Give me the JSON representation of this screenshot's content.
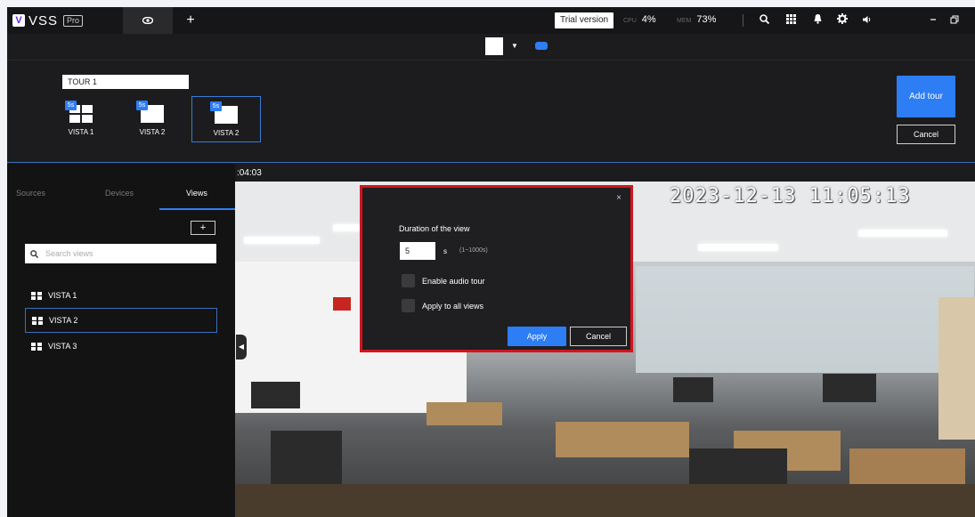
{
  "app": {
    "logo_letter": "V",
    "name": "VSS",
    "edition": "Pro",
    "live_icon": "eye-icon",
    "add_tab_icon": "+"
  },
  "topbar": {
    "trial_label": "Trial version",
    "cpu_label": "CPU",
    "cpu_value": "4%",
    "mem_label": "MEM",
    "mem_value": "73%",
    "icons": [
      "search-icon",
      "apps-grid-icon",
      "bell-icon",
      "gear-icon",
      "volume-icon",
      "minimize-icon",
      "restore-icon"
    ]
  },
  "tour": {
    "name": "TOUR 1",
    "views": [
      {
        "label": "VISTA 1",
        "badge": "5s"
      },
      {
        "label": "VISTA 2",
        "badge": "5s"
      },
      {
        "label": "VISTA 2",
        "badge": "5s"
      }
    ],
    "add_label": "Add tour",
    "cancel_label": "Cancel"
  },
  "sidebar": {
    "tabs": [
      "Sources",
      "Devices",
      "Views"
    ],
    "active_tab": "Views",
    "add_label": "+",
    "search_placeholder": "Search views",
    "views": [
      "VISTA 1",
      "VISTA 2",
      "VISTA 3"
    ],
    "selected_view": "VISTA 2"
  },
  "video": {
    "strip_time": ":04:03",
    "timestamp": "2023-12-13 11:05:13"
  },
  "modal": {
    "close": "×",
    "title": "Duration of the view",
    "duration_value": "5",
    "unit": "s",
    "range": "(1~1000s)",
    "audio_label": "Enable audio tour",
    "apply_all_label": "Apply to all views",
    "apply_label": "Apply",
    "cancel_label": "Cancel"
  },
  "colors": {
    "accent": "#2d7df5",
    "highlight_border": "#d2151e",
    "background": "#1c1c1e"
  }
}
